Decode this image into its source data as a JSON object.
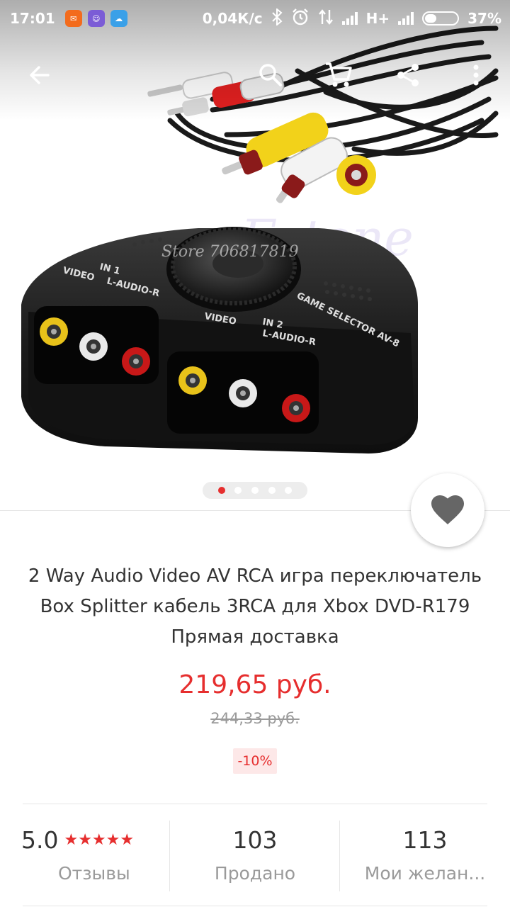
{
  "status_bar": {
    "time": "17:01",
    "net_speed": "0,04К/с",
    "network_type": "H+",
    "battery_percent": "37%",
    "battery_level": 0.37,
    "colors": {
      "app1": "#f36b1c",
      "app2": "#7b5cd6",
      "app3": "#3aa0e8"
    }
  },
  "toolbar": {
    "icons": [
      "back-arrow-icon",
      "search-icon",
      "cart-icon",
      "share-icon",
      "more-vert-icon"
    ]
  },
  "gallery": {
    "watermark_brand": "Estone",
    "watermark_store": "Store 706817819",
    "device_labels": {
      "in1": "IN 1",
      "in2": "IN 2",
      "video": "VIDEO",
      "audio": "L-AUDIO-R",
      "selector": "GAME SELECTOR AV-8"
    },
    "page_count": 5,
    "current_page": 1
  },
  "product": {
    "title": "2 Way Audio Video AV RCA игра переключатель Box Splitter кабель 3RCA для Xbox DVD-R179 Прямая доставка",
    "price": "219,65 руб.",
    "old_price": "244,33 руб.",
    "discount": "-10%"
  },
  "stats": {
    "rating": "5.0",
    "stars": "★★★★★",
    "reviews_label": "Отзывы",
    "sold_value": "103",
    "sold_label": "Продано",
    "wishlist_value": "113",
    "wishlist_label": "Мои желан..."
  },
  "colors": {
    "accent": "#e62e2e",
    "text": "#333333",
    "muted": "#9a9a9a",
    "discount_bg": "#fde8e8"
  }
}
